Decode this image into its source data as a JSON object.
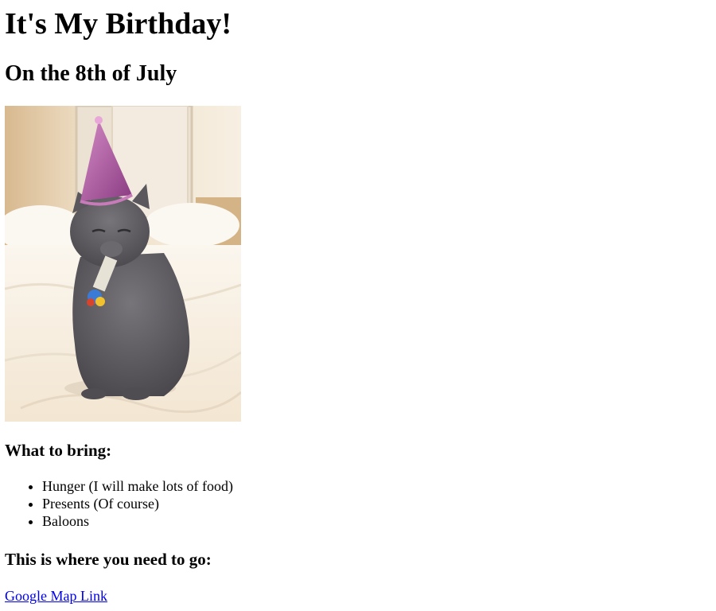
{
  "page": {
    "title": "It's My Birthday!",
    "subtitle": "On the 8th of July",
    "image": {
      "subject": "grey-cat-party-hat-icon",
      "colors": {
        "background": "#f4ead9",
        "bed": "#faf3ea",
        "cat": "#5d5b60",
        "hat": "#b85ea8"
      }
    },
    "bring": {
      "heading": "What to bring:",
      "items": [
        "Hunger (I will make lots of food)",
        "Presents (Of course)",
        "Baloons"
      ]
    },
    "directions": {
      "heading": "This is where you need to go:",
      "link_text": "Google Map Link"
    },
    "link_color": "#0000ee"
  }
}
